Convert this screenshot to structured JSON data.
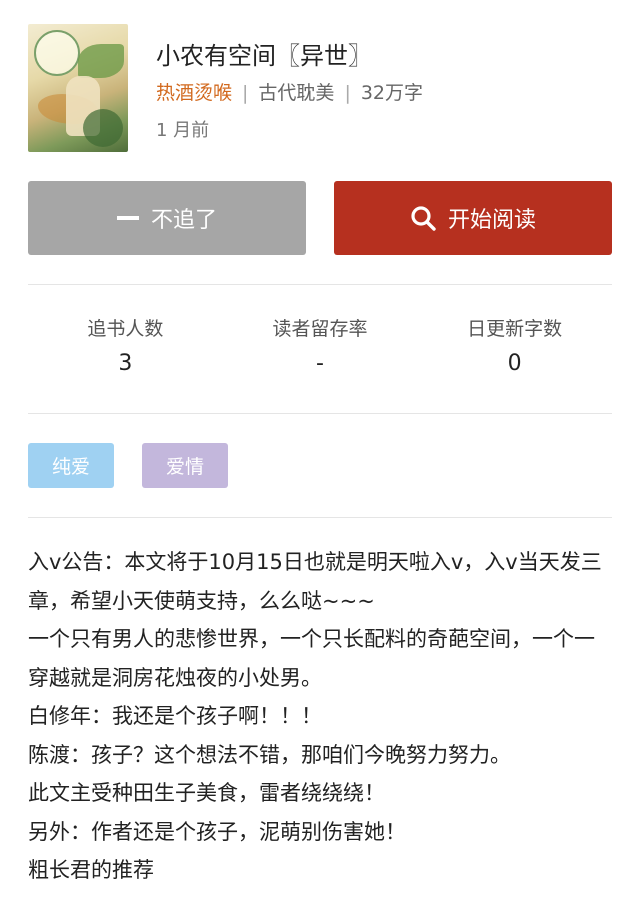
{
  "book": {
    "title": "小农有空间〖异世〗",
    "author": "热酒烫喉",
    "category": "古代耽美",
    "word_count": "32万字",
    "updated": "1 月前"
  },
  "buttons": {
    "unfollow_label": "不追了",
    "read_label": "开始阅读"
  },
  "stats": [
    {
      "label": "追书人数",
      "value": "3"
    },
    {
      "label": "读者留存率",
      "value": "-"
    },
    {
      "label": "日更新字数",
      "value": "0"
    }
  ],
  "tags": [
    {
      "label": "纯爱",
      "color": "#9fd1f2"
    },
    {
      "label": "爱情",
      "color": "#c3b7dc"
    }
  ],
  "description": [
    "入v公告：本文将于10月15日也就是明天啦入v，入v当天发三章，希望小天使萌支持，么么哒~~~",
    "一个只有男人的悲惨世界，一个只长配料的奇葩空间，一个一穿越就是洞房花烛夜的小处男。",
    "白修年：我还是个孩子啊！！！",
    "陈渡：孩子？这个想法不错，那咱们今晚努力努力。",
    "此文主受种田生子美食，雷者绕绕绕！",
    "另外：作者还是个孩子，泥萌别伤害她！",
    "粗长君的推荐"
  ],
  "colors": {
    "accent": "#b6301f",
    "author": "#d2691e",
    "button_gray": "#a6a6a6"
  },
  "icons": {
    "unfollow": "minus-icon",
    "read": "search-icon"
  }
}
